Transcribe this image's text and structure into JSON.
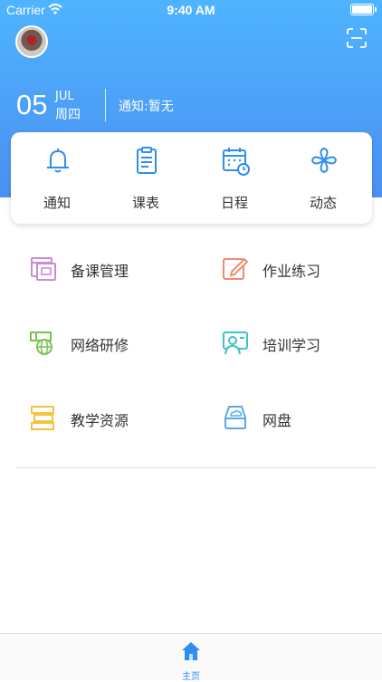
{
  "status_bar": {
    "carrier": "Carrier",
    "time": "9:40 AM"
  },
  "header": {
    "day": "05",
    "month": "JUL",
    "weekday": "周四",
    "notice": "通知:暂无"
  },
  "quick_actions": [
    {
      "label": "通知",
      "icon": "bell-icon"
    },
    {
      "label": "课表",
      "icon": "clipboard-icon"
    },
    {
      "label": "日程",
      "icon": "calendar-icon"
    },
    {
      "label": "动态",
      "icon": "pinwheel-icon"
    }
  ],
  "menu": [
    {
      "label": "备课管理",
      "icon": "lesson-prep-icon",
      "color": "#c98bd6"
    },
    {
      "label": "作业练习",
      "icon": "homework-icon",
      "color": "#f08a6a"
    },
    {
      "label": "网络研修",
      "icon": "online-training-icon",
      "color": "#7cc253"
    },
    {
      "label": "培训学习",
      "icon": "training-study-icon",
      "color": "#3fc2c9"
    },
    {
      "label": "教学资源",
      "icon": "teaching-resources-icon",
      "color": "#f3c43b"
    },
    {
      "label": "网盘",
      "icon": "cloud-drive-icon",
      "color": "#5aa9e6"
    }
  ],
  "tab_bar": {
    "home_label": "主页"
  },
  "colors": {
    "header_top": "#4fb4ff",
    "header_bottom": "#4a90f0",
    "accent": "#2f8ef0"
  }
}
